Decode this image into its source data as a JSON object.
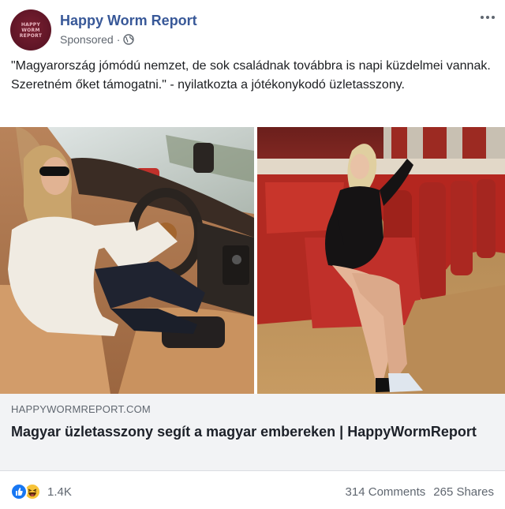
{
  "post": {
    "page_name": "Happy Worm Report",
    "avatar_text": "HAPPY WORM REPORT",
    "sponsored_label": "Sponsored",
    "separator": "·",
    "privacy_icon": "globe-icon",
    "more_icon": "more-options-icon",
    "text": "\"Magyarország jómódú nemzet, de sok családnak továbbra is napi küzdelmei vannak. Szeretném őket támogatni.\" - nyilatkozta a jótékonykodó üzletasszony."
  },
  "link_preview": {
    "domain": "HAPPYWORMREPORT.COM",
    "title": "Magyar üzletasszony segít a magyar embereken | HappyWormReport"
  },
  "footer": {
    "reaction_icons": [
      "like-icon",
      "haha-icon"
    ],
    "reaction_count": "1.4K",
    "comments": "314 Comments",
    "shares": "265 Shares"
  },
  "colors": {
    "page_name": "#385898",
    "like": "#1877f2",
    "haha": "#f7c338",
    "link_box_bg": "#f2f3f5",
    "avatar_bg": "#5e1526"
  }
}
